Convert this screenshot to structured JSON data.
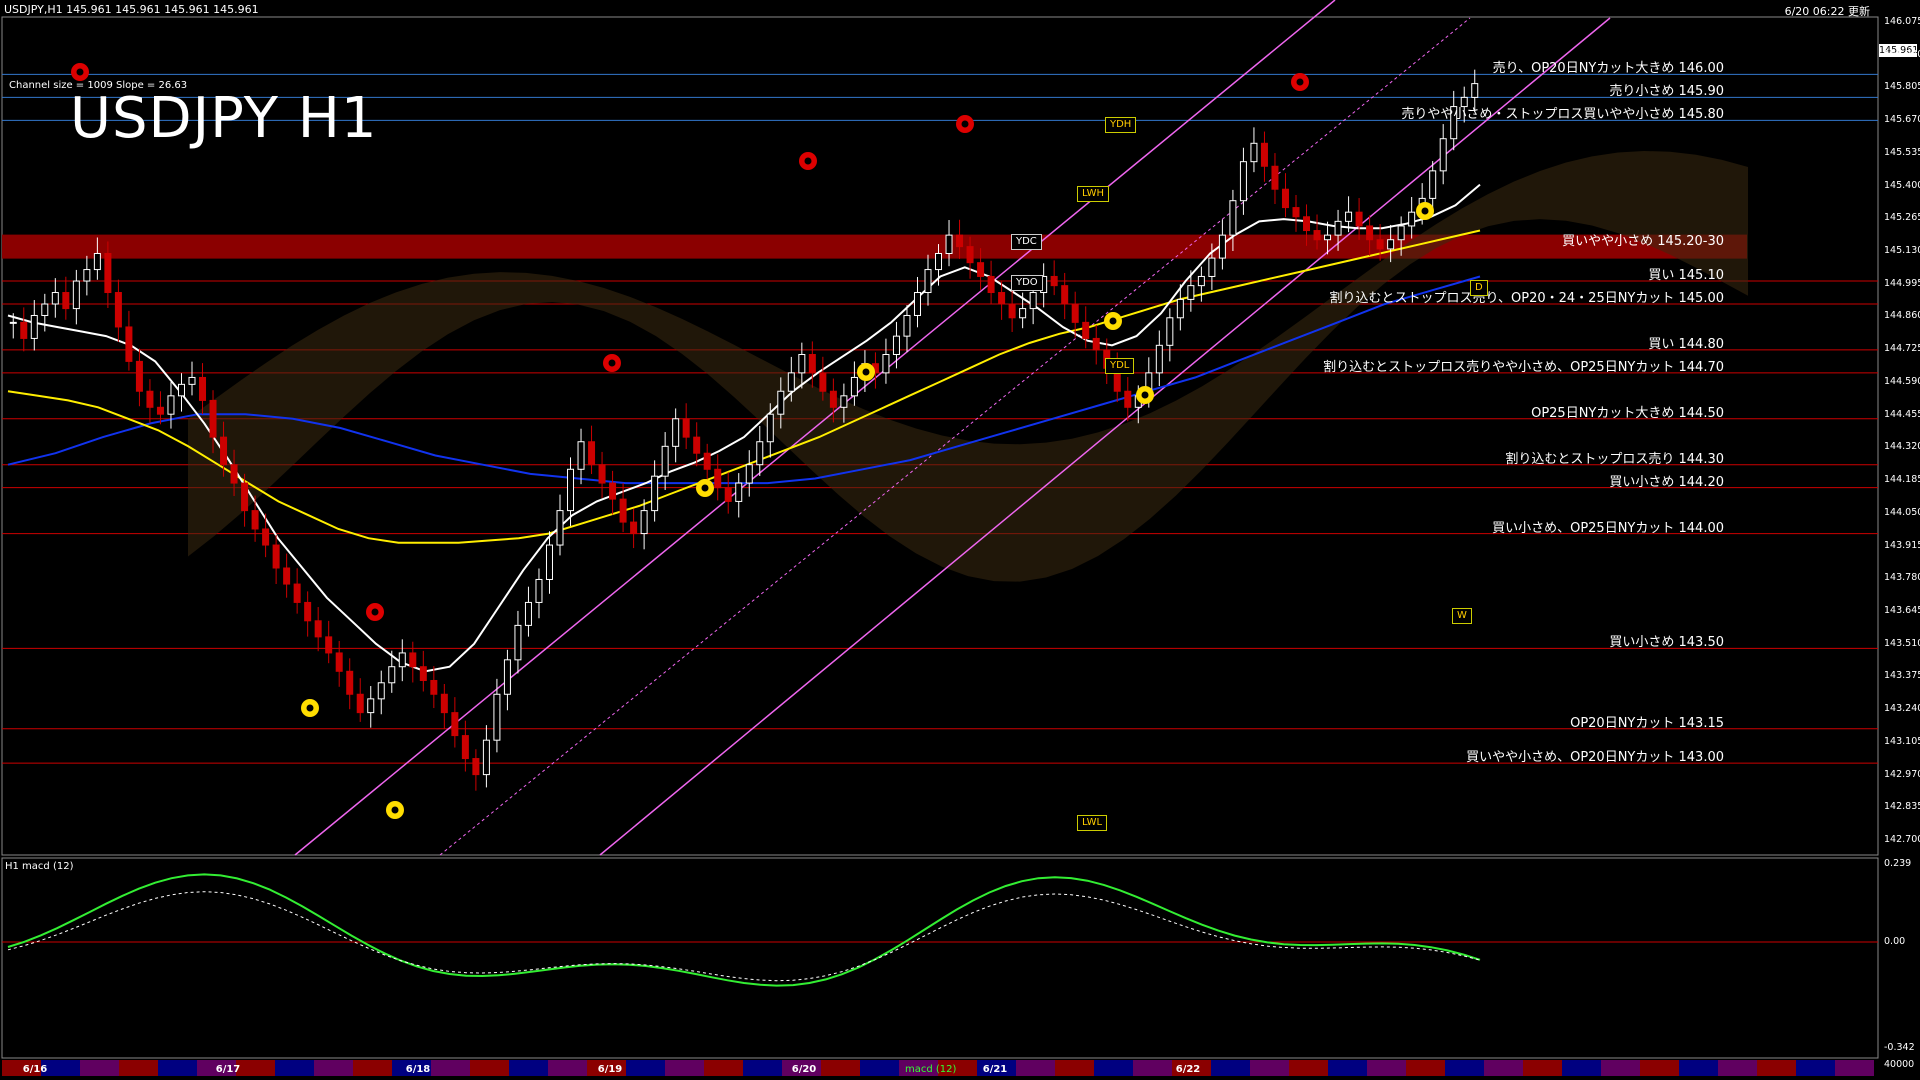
{
  "header": {
    "symbol_info": "USDJPY,H1  145.961 145.961 145.961 145.961",
    "updated": "6/20 06:22 更新",
    "channel_info": "Channel size = 1009  Slope = 26.63",
    "big_title": "USDJPY H1",
    "macd_label": "H1  macd (12)"
  },
  "price_axis": {
    "min": 142.7,
    "max": 146.15,
    "ticks": [
      "146.075",
      "145.940",
      "145.805",
      "145.670",
      "145.535",
      "145.400",
      "145.265",
      "145.130",
      "144.995",
      "144.860",
      "144.725",
      "144.590",
      "144.455",
      "144.320",
      "144.185",
      "144.050",
      "143.915",
      "143.780",
      "143.645",
      "143.510",
      "143.375",
      "143.240",
      "143.105",
      "142.970",
      "142.835",
      "142.700"
    ],
    "current_price": "145.961"
  },
  "macd_axis": {
    "ticks": [
      "0.239",
      "0.00",
      "-0.342",
      "40000"
    ]
  },
  "dates": [
    "6/16",
    "6/17",
    "6/18",
    "6/19",
    "6/20",
    "6/21",
    "6/22"
  ],
  "bottom_tag": "macd (12)",
  "colors": {
    "background": "#000000",
    "up": "#ffffff",
    "down": "#cc0000",
    "channel": "#ee66ee",
    "ma_fast": "#ffffff",
    "ma_mid": "#ffee00",
    "ma_slow": "#1133ee",
    "chikou": "#22bb22",
    "macd": "#33ee33",
    "signal": "#ffffff",
    "level": "#cc0000"
  },
  "chart_data": {
    "type": "candlestick",
    "title": "USDJPY H1",
    "timeframe": "H1",
    "ylim": [
      142.7,
      146.15
    ],
    "levels": [
      {
        "price": 146.0,
        "text": "売り、OP20日NYカット大きめ 146.00"
      },
      {
        "price": 145.9,
        "text": "売り小さめ 145.90"
      },
      {
        "price": 145.8,
        "text": "売りやや小さめ・ストップロス買いやや小さめ 145.80"
      },
      {
        "price": 145.25,
        "text": "買いやや小さめ 145.20-30"
      },
      {
        "price": 145.1,
        "text": "買い 145.10"
      },
      {
        "price": 145.0,
        "text": "割り込むとストップロス売り、OP20・24・25日NYカット 145.00"
      },
      {
        "price": 144.8,
        "text": "買い 144.80"
      },
      {
        "price": 144.7,
        "text": "割り込むとストップロス売りやや小さめ、OP25日NYカット 144.70"
      },
      {
        "price": 144.5,
        "text": "OP25日NYカット大きめ 144.50"
      },
      {
        "price": 144.3,
        "text": "割り込むとストップロス売り 144.30"
      },
      {
        "price": 144.2,
        "text": "買い小さめ 144.20"
      },
      {
        "price": 144.0,
        "text": "買い小さめ、OP25日NYカット 144.00"
      },
      {
        "price": 143.5,
        "text": "買い小さめ 143.50"
      },
      {
        "price": 143.15,
        "text": "OP20日NYカット 143.15"
      },
      {
        "price": 143.0,
        "text": "買いやや小さめ、OP20日NYカット 143.00"
      }
    ],
    "markers": [
      {
        "text": "YDH",
        "price": 145.78
      },
      {
        "text": "LWH",
        "price": 145.48
      },
      {
        "text": "YDC",
        "price": 145.27
      },
      {
        "text": "YDO",
        "price": 145.09
      },
      {
        "text": "YDL",
        "price": 144.73
      },
      {
        "text": "LWL",
        "price": 142.74
      },
      {
        "text": "W",
        "price": 143.64
      },
      {
        "text": "D",
        "price": 145.07
      }
    ],
    "close": [
      144.92,
      144.85,
      144.95,
      145.0,
      145.05,
      144.98,
      145.1,
      145.15,
      145.22,
      145.05,
      144.9,
      144.75,
      144.62,
      144.55,
      144.52,
      144.6,
      144.65,
      144.68,
      144.58,
      144.42,
      144.3,
      144.22,
      144.1,
      144.02,
      143.95,
      143.85,
      143.78,
      143.7,
      143.62,
      143.55,
      143.48,
      143.4,
      143.3,
      143.22,
      143.28,
      143.35,
      143.42,
      143.48,
      143.42,
      143.36,
      143.3,
      143.22,
      143.12,
      143.02,
      142.95,
      143.1,
      143.3,
      143.45,
      143.6,
      143.7,
      143.8,
      143.95,
      144.1,
      144.28,
      144.4,
      144.3,
      144.22,
      144.15,
      144.05,
      144.0,
      144.1,
      144.25,
      144.38,
      144.5,
      144.42,
      144.35,
      144.28,
      144.2,
      144.14,
      144.22,
      144.3,
      144.4,
      144.52,
      144.62,
      144.7,
      144.78,
      144.7,
      144.62,
      144.55,
      144.6,
      144.68,
      144.74,
      144.7,
      144.78,
      144.86,
      144.95,
      145.05,
      145.15,
      145.22,
      145.3,
      145.25,
      145.18,
      145.12,
      145.05,
      145.0,
      144.94,
      144.98,
      145.05,
      145.12,
      145.08,
      145.0,
      144.92,
      144.85,
      144.8,
      144.72,
      144.62,
      144.55,
      144.6,
      144.7,
      144.82,
      144.94,
      145.02,
      145.08,
      145.12,
      145.2,
      145.3,
      145.45,
      145.62,
      145.7,
      145.6,
      145.5,
      145.42,
      145.38,
      145.32,
      145.28,
      145.3,
      145.36,
      145.4,
      145.34,
      145.28,
      145.24,
      145.28,
      145.34,
      145.4,
      145.46,
      145.58,
      145.72,
      145.86,
      145.9,
      145.96
    ],
    "ma_fast": [
      144.95,
      144.92,
      144.9,
      144.88,
      144.86,
      144.82,
      144.75,
      144.62,
      144.48,
      144.32,
      144.15,
      143.98,
      143.85,
      143.72,
      143.62,
      143.52,
      143.44,
      143.4,
      143.42,
      143.52,
      143.68,
      143.84,
      143.98,
      144.08,
      144.14,
      144.18,
      144.22,
      144.27,
      144.31,
      144.36,
      144.42,
      144.52,
      144.62,
      144.7,
      144.77,
      144.84,
      144.92,
      145.02,
      145.12,
      145.16,
      145.12,
      145.05,
      144.98,
      144.9,
      144.84,
      144.82,
      144.86,
      144.96,
      145.1,
      145.22,
      145.3,
      145.36,
      145.37,
      145.36,
      145.34,
      145.33,
      145.33,
      145.35,
      145.38,
      145.43,
      145.52
    ],
    "ma_mid": [
      144.62,
      144.6,
      144.58,
      144.55,
      144.5,
      144.45,
      144.38,
      144.3,
      144.22,
      144.14,
      144.08,
      144.02,
      143.98,
      143.96,
      143.96,
      143.96,
      143.97,
      143.98,
      144.0,
      144.04,
      144.08,
      144.12,
      144.17,
      144.22,
      144.27,
      144.32,
      144.37,
      144.42,
      144.48,
      144.54,
      144.6,
      144.66,
      144.72,
      144.78,
      144.83,
      144.87,
      144.9,
      144.94,
      144.98,
      145.02,
      145.05,
      145.08,
      145.11,
      145.14,
      145.17,
      145.2,
      145.23,
      145.26,
      145.29,
      145.32
    ],
    "ma_slow": [
      144.3,
      144.35,
      144.42,
      144.48,
      144.52,
      144.52,
      144.5,
      144.46,
      144.4,
      144.34,
      144.3,
      144.26,
      144.24,
      144.22,
      144.22,
      144.22,
      144.22,
      144.24,
      144.28,
      144.32,
      144.38,
      144.44,
      144.5,
      144.56,
      144.62,
      144.68,
      144.76,
      144.84,
      144.92,
      145.0,
      145.06,
      145.12
    ]
  }
}
